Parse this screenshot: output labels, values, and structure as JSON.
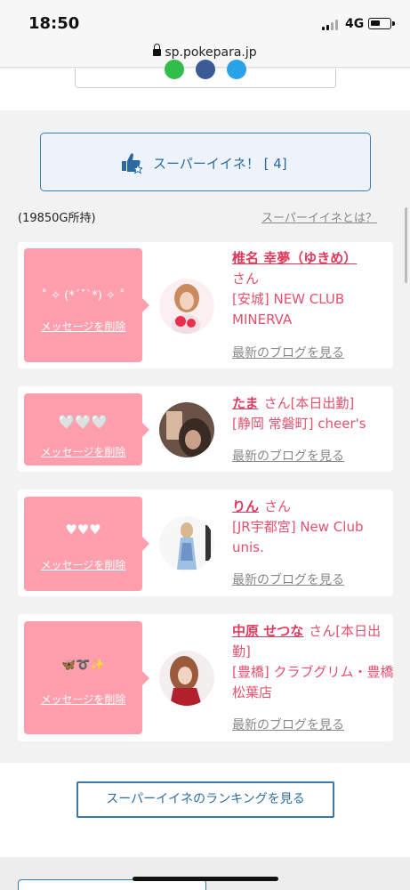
{
  "status_bar": {
    "time": "18:50",
    "network": "4G"
  },
  "browser": {
    "url": "sp.pokepara.jp"
  },
  "share_icons": [
    "line-icon",
    "facebook-icon",
    "twitter-icon"
  ],
  "super_iine": {
    "label": "スーパーイイネ！ [ 4]",
    "icon": "thumbs-up-star-icon"
  },
  "owned_points": "(19850G所持)",
  "about_link": "スーパーイイネとは？",
  "messages": [
    {
      "message": "˚ ✧ (*´ˇ`*) ✧ ˚",
      "delete_label": "メッセージを削除",
      "name": "椎名 幸夢（ゆきめ）",
      "suffix": "さん",
      "shop": "[安城] NEW CLUB MINERVA",
      "blog_label": "最新のブログを見る"
    },
    {
      "message": "🤍🤍🤍",
      "delete_label": "メッセージを削除",
      "name": "たま",
      "suffix": "さん[本日出勤]",
      "shop": "[静岡 常磐町] cheer's",
      "blog_label": "最新のブログを見る"
    },
    {
      "message": "♥♥♥",
      "delete_label": "メッセージを削除",
      "name": "りん",
      "suffix": "さん",
      "shop": "[JR宇都宮] New Club unis.",
      "blog_label": "最新のブログを見る"
    },
    {
      "message": "🦋➰✨",
      "delete_label": "メッセージを削除",
      "name": "中原 せつな",
      "suffix": "さん[本日出勤]",
      "shop": "[豊橋] クラブグリム・豊橋松葉店",
      "blog_label": "最新のブログを見る"
    }
  ],
  "ranking_button": "スーパーイイネのランキングを見る",
  "colors": {
    "accent_pink": "#e5506e",
    "message_bg": "#ff9fad",
    "button_blue": "#3b7fb5"
  }
}
